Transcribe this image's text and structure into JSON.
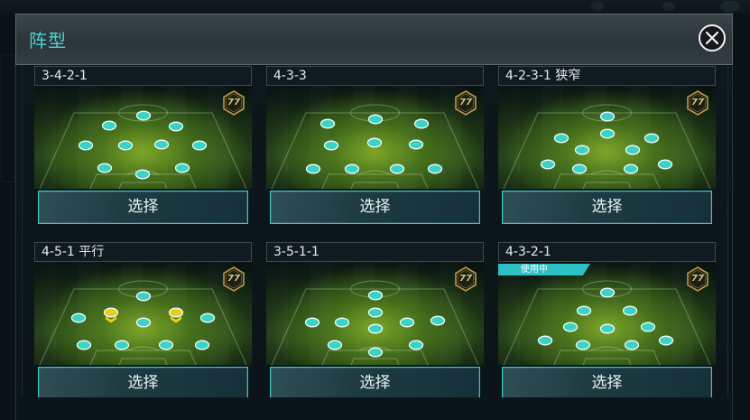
{
  "header": {
    "title": "阵型"
  },
  "icons": {
    "close": "close-icon",
    "rating": "hexagon-rating-icon",
    "player": "player-marker"
  },
  "colors": {
    "accent": "#3ec6c6",
    "title": "#4fd3d3",
    "player_marker": "#3dd3c4",
    "highlight_marker": "#e6cf1e",
    "rating_gold": "#b89a4c",
    "status_badge": "#2ec1c3"
  },
  "formations": [
    {
      "name": "3-4-2-1",
      "rating": "77",
      "button_label": "选择"
    },
    {
      "name": "4-3-3",
      "rating": "77",
      "button_label": "选择"
    },
    {
      "name": "4-2-3-1 狭窄",
      "rating": "77",
      "button_label": "选择"
    },
    {
      "name": "4-5-1 平行",
      "rating": "77",
      "button_label": "选择"
    },
    {
      "name": "3-5-1-1",
      "rating": "77",
      "button_label": "选择"
    },
    {
      "name": "4-3-2-1",
      "rating": "77",
      "button_label": "选择",
      "status_badge": "使用中"
    }
  ]
}
